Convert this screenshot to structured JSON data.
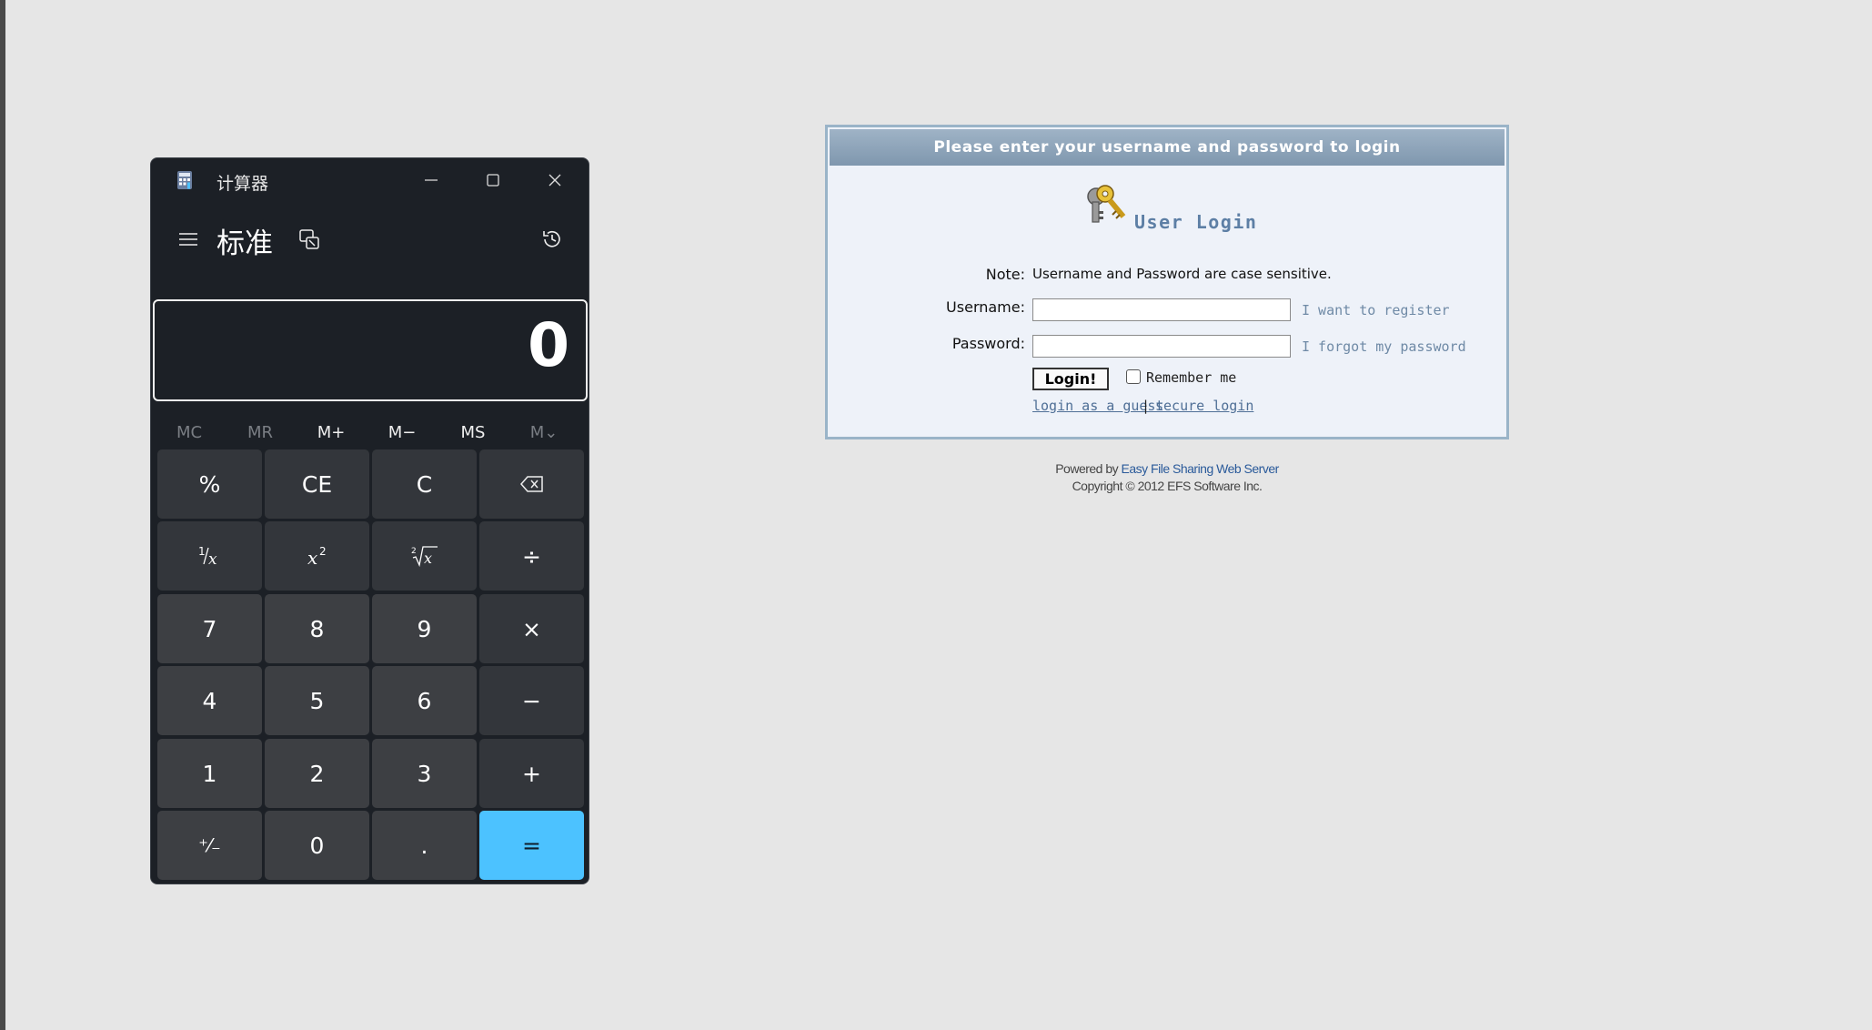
{
  "calculator": {
    "window_title": "计算器",
    "mode": "标准",
    "display_value": "0",
    "memory": [
      "MC",
      "MR",
      "M+",
      "M−",
      "MS",
      "M⌄"
    ],
    "keys": {
      "percent": "%",
      "ce": "CE",
      "clear": "C",
      "seven": "7",
      "eight": "8",
      "nine": "9",
      "four": "4",
      "five": "5",
      "six": "6",
      "one": "1",
      "two": "2",
      "three": "3",
      "negate": "⁺⁄₋",
      "zero": "0",
      "decimal": ".",
      "divide": "÷",
      "multiply": "×",
      "minus": "−",
      "plus": "+",
      "equals": "="
    },
    "colors": {
      "accent": "#4cc2ff",
      "background": "#1c2026"
    }
  },
  "login": {
    "header": "Please enter your username and password to login",
    "title": "User Login",
    "note_label": "Note:",
    "note_text": "Username and Password are case sensitive.",
    "username_label": "Username:",
    "username_value": "",
    "password_label": "Password:",
    "password_value": "",
    "register_link": "I want to register",
    "forgot_link": "I forgot my password",
    "login_button": "Login!",
    "remember_label": "Remember me",
    "remember_checked": false,
    "guest_link": "login as a guest",
    "separator": "|",
    "secure_link": "secure login"
  },
  "footer": {
    "powered_prefix": "Powered by",
    "powered_link": "Easy File Sharing Web Server",
    "copyright": "Copyright © 2012 EFS Software Inc."
  }
}
